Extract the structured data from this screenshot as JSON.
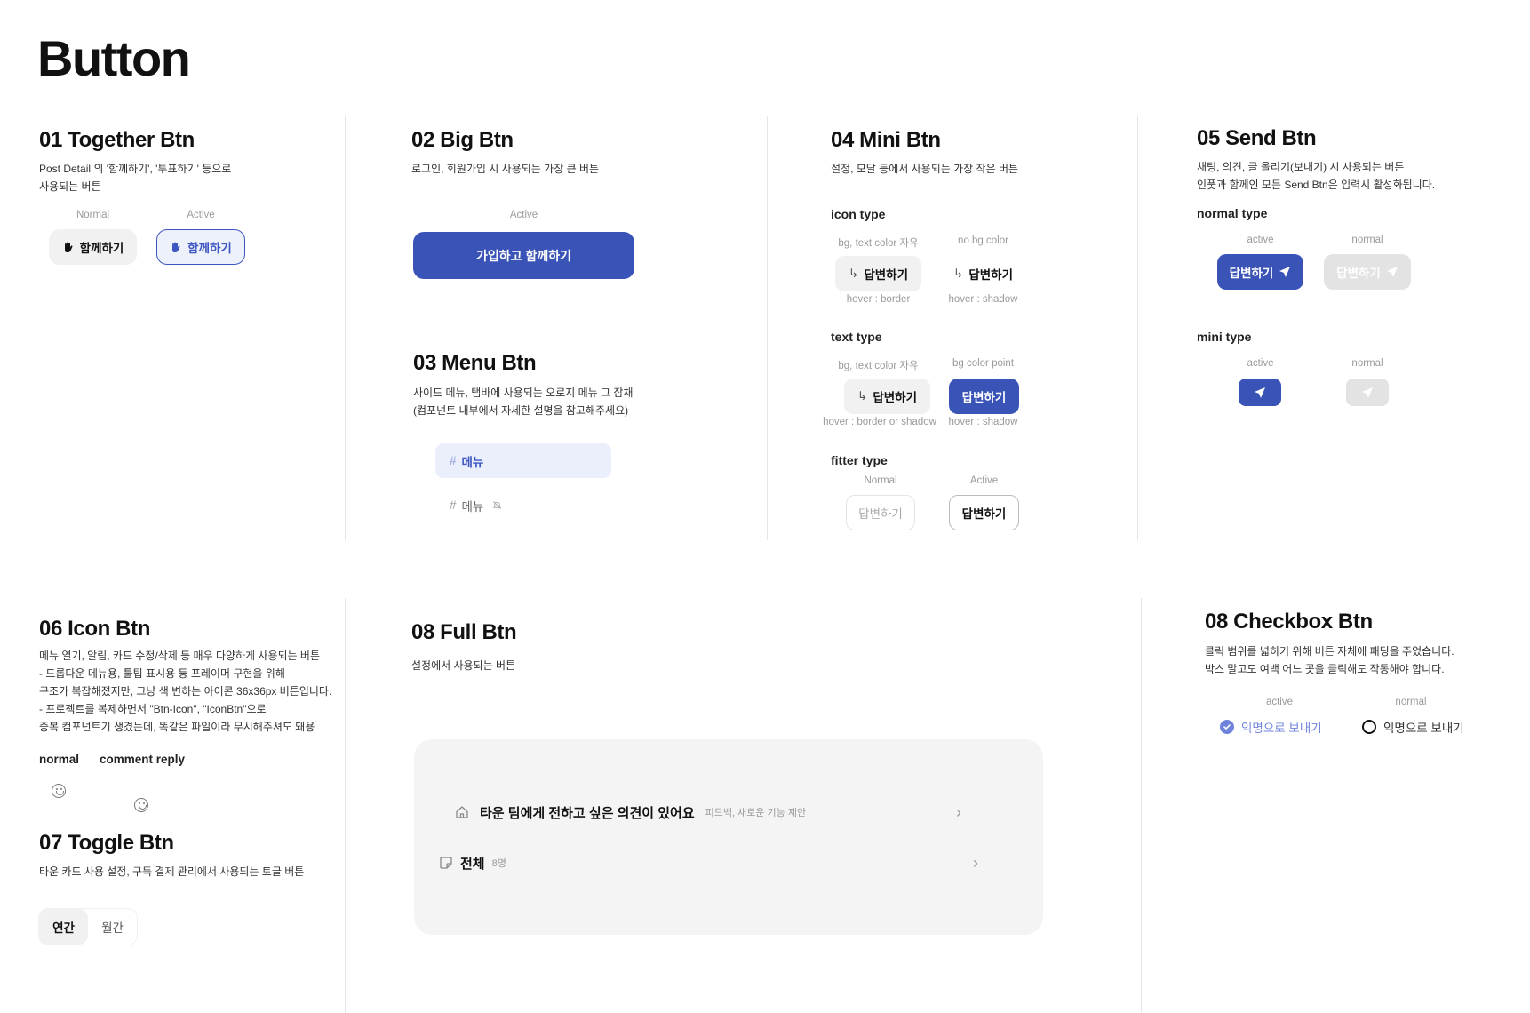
{
  "page_title": "Button",
  "s01": {
    "title": "01 Together Btn",
    "desc": "Post Detail 의 '함께하기', '투표하기' 등으로\n사용되는 버튼",
    "label_normal": "Normal",
    "label_active": "Active",
    "btn_label": "함께하기",
    "icon": "hand-icon"
  },
  "s02": {
    "title": "02 Big Btn",
    "desc": "로그인, 회원가입 시 사용되는 가장 큰 버튼",
    "label_active": "Active",
    "btn_label": "가입하고 함께하기"
  },
  "s03": {
    "title": "03 Menu Btn",
    "desc": "사이드 메뉴, 탭바에 사용되는 오로지 메뉴 그 잡채\n(컴포넌트 내부에서 자세한 설명을 참고해주세요)",
    "hash": "#",
    "menu_label": "메뉴",
    "mute_icon": "bell-off-icon"
  },
  "s04": {
    "title": "04 Mini Btn",
    "desc": "설정, 모달 등에서 사용되는 가장 작은 버튼",
    "icon_type": {
      "title": "icon type",
      "label_left": "bg, text color 자유",
      "label_right": "no bg color",
      "hover_left": "hover : border",
      "hover_right": "hover : shadow"
    },
    "text_type": {
      "title": "text type",
      "label_left": "bg, text color 자유",
      "label_right": "bg color point",
      "hover_left": "hover : border or shadow",
      "hover_right": "hover : shadow"
    },
    "filter_type": {
      "title": "fitter type",
      "label_normal": "Normal",
      "label_active": "Active"
    },
    "btn_label": "답변하기",
    "arrow_glyph": "↳"
  },
  "s05": {
    "title": "05 Send Btn",
    "desc": "채팅, 의견, 글 올리기(보내기) 시 사용되는 버튼\n인풋과 함께인 모든 Send Btn은 입력시 활성화됩니다.",
    "normal_type": "normal type",
    "mini_type": "mini type",
    "label_active": "active",
    "label_normal": "normal",
    "btn_label": "답변하기"
  },
  "s06": {
    "title": "06 Icon Btn",
    "desc": "메뉴 열기, 알림, 카드 수정/삭제 등 매우 다양하게 사용되는 버튼\n- 드롭다운 메뉴용, 툴팁 표시용 등 프레이머 구현을 위해\n구조가 복잡해졌지만, 그냥 색 변하는 아이콘 36x36px 버튼입니다.\n- 프로젝트를 복제하면서 \"Btn-Icon\", \"IconBtn\"으로\n중복 컴포넌트기 생겼는데, 똑같은 파일이라 무시해주셔도 돼용",
    "label_normal": "normal",
    "label_comment": "comment reply"
  },
  "s07": {
    "title": "07 Toggle Btn",
    "desc": "타운 카드 사용 설정, 구독 결제 관리에서 사용되는 토글 버튼",
    "options": [
      "연간",
      "월간"
    ]
  },
  "s08_full": {
    "title": "08 Full Btn",
    "desc": "설정에서 사용되는 버튼",
    "row1_main": "타운 팀에게 전하고 싶은 의견이 있어요",
    "row1_sub": "피드백, 새로운 기능 제안",
    "row2_main": "전체",
    "row2_sub": "8명",
    "chevron": "›"
  },
  "s08_checkbox": {
    "title": "08 Checkbox Btn",
    "desc": "클릭 범위를 넓히기 위해 버튼 자체에 패딩을 주었습니다.\n박스 말고도 여백 어느 곳을 클릭해도 작동해야 합니다.",
    "label_active": "active",
    "label_normal": "normal",
    "option_label": "익명으로 보내기"
  },
  "colors": {
    "primary": "#3a53b7",
    "primary_light": "#ebeefb",
    "check": "#6f83dc",
    "disabled": "#e3e3e3"
  }
}
